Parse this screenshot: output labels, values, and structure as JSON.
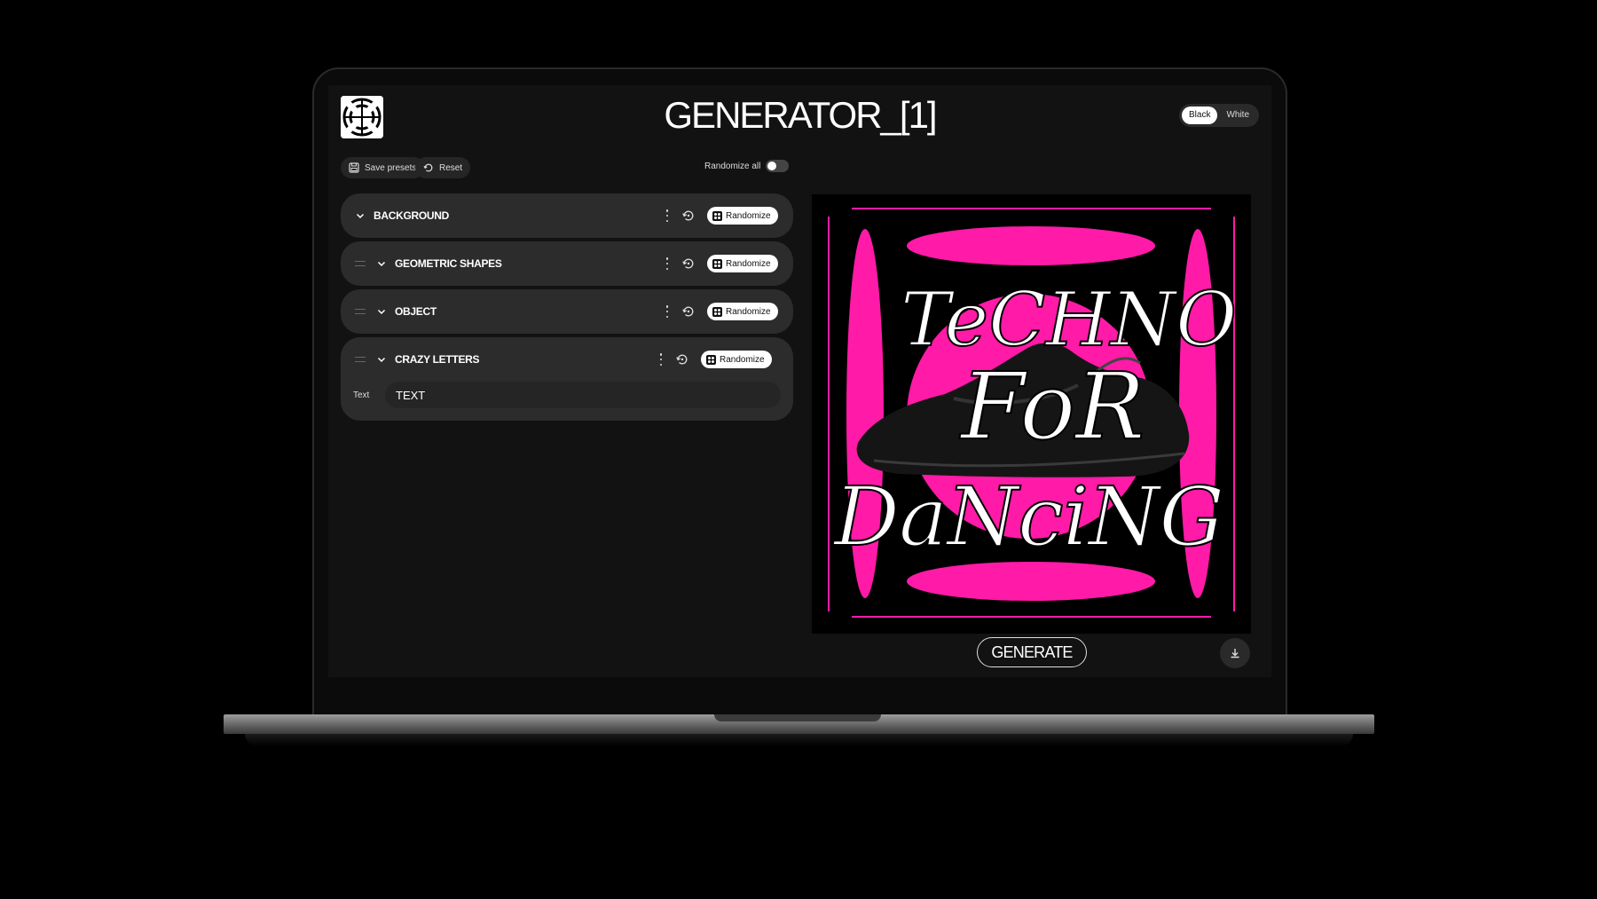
{
  "app": {
    "title": "GENERATOR_[1]"
  },
  "theme": {
    "options": [
      "Black",
      "White"
    ],
    "selected": "Black"
  },
  "toolbar": {
    "save_label": "Save presets",
    "reset_label": "Reset",
    "randomize_all_label": "Randomize all",
    "randomize_all_on": false
  },
  "sections": [
    {
      "label": "BACKGROUND",
      "randomize_label": "Randomize"
    },
    {
      "label": "GEOMETRIC SHAPES",
      "randomize_label": "Randomize"
    },
    {
      "label": "OBJECT",
      "randomize_label": "Randomize"
    },
    {
      "label": "CRAZY LETTERS",
      "randomize_label": "Randomize",
      "text_label": "Text",
      "text_value": "TEXT"
    }
  ],
  "preview": {
    "art_lines": [
      "TeCHNO",
      "FoR",
      "DaNciNG"
    ],
    "colors": {
      "accent": "#ff1aa8",
      "background": "#000000"
    }
  },
  "actions": {
    "generate_label": "GENERATE"
  },
  "icons": {
    "logo": "swirl-logo",
    "download": "download-icon",
    "reset": "refresh-icon",
    "menu": "kebab-menu-icon",
    "randomize": "dice-icon"
  }
}
